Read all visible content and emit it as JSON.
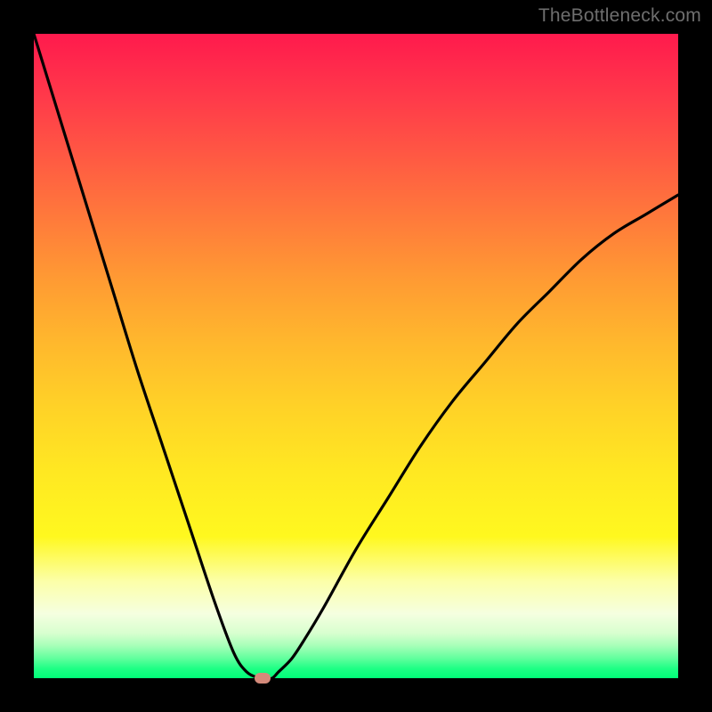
{
  "watermark": "TheBottleneck.com",
  "chart_data": {
    "type": "line",
    "title": "",
    "xlabel": "",
    "ylabel": "",
    "xlim": [
      0,
      100
    ],
    "ylim": [
      0,
      100
    ],
    "background_gradient": {
      "top": "#ff1a4d",
      "mid": "#ffe822",
      "bottom": "#00ff78"
    },
    "series": [
      {
        "name": "bottleneck-curve",
        "x": [
          0,
          4,
          8,
          12,
          16,
          20,
          24,
          28,
          31,
          33,
          35,
          36,
          37,
          38,
          40,
          42,
          45,
          50,
          55,
          60,
          65,
          70,
          75,
          80,
          85,
          90,
          95,
          100
        ],
        "y": [
          100,
          87,
          74,
          61,
          48,
          36,
          24,
          12,
          4,
          1,
          0,
          0,
          0,
          1,
          3,
          6,
          11,
          20,
          28,
          36,
          43,
          49,
          55,
          60,
          65,
          69,
          72,
          75
        ]
      }
    ],
    "marker": {
      "x": 35.5,
      "y": 0,
      "color": "#d48a7a"
    }
  }
}
